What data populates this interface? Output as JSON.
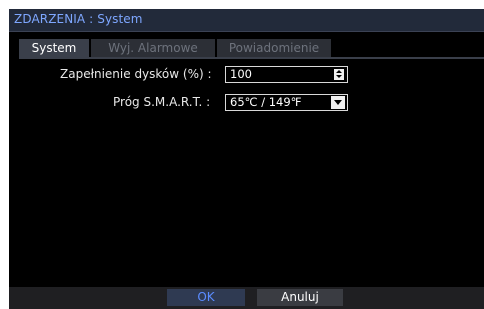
{
  "window": {
    "title_prefix": "ZDARZENIA",
    "title_sep": ":",
    "title_page": "System"
  },
  "tabs": [
    {
      "label": "System",
      "active": true
    },
    {
      "label": "Wyj. Alarmowe",
      "active": false
    },
    {
      "label": "Powiadomienie",
      "active": false
    }
  ],
  "settings": {
    "disk_full": {
      "label": "Zapełnienie dysków (%)",
      "sep": ":",
      "value": "100"
    },
    "smart": {
      "label": "Próg S.M.A.R.T.",
      "sep": ":",
      "value": "65℃ / 149℉"
    }
  },
  "buttons": {
    "ok": "OK",
    "cancel": "Anuluj"
  },
  "colors": {
    "title_text": "#7ea7ff",
    "ok_text": "#5b8cff",
    "background": "#000000"
  }
}
